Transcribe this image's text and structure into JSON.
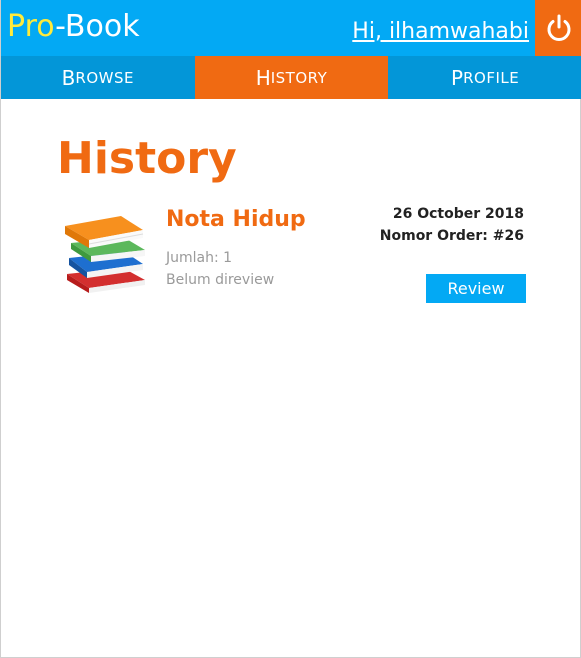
{
  "header": {
    "logo_pro": "Pro",
    "logo_dash": "-",
    "logo_book": "Book",
    "greeting": "Hi, ilhamwahabi",
    "logout_icon": "power-icon"
  },
  "nav": {
    "tabs": [
      {
        "first": "B",
        "rest": "ROWSE",
        "active": false
      },
      {
        "first": "H",
        "rest": "ISTORY",
        "active": true
      },
      {
        "first": "P",
        "rest": "ROFILE",
        "active": false
      }
    ]
  },
  "main": {
    "title": "History",
    "orders": [
      {
        "book_title": "Nota Hidup",
        "quantity": "Jumlah: 1",
        "review_status": "Belum direview",
        "date": "26 October 2018",
        "order_number": "Nomor Order: #26",
        "review_label": "Review",
        "image": "books-stack-image"
      }
    ]
  },
  "colors": {
    "primary": "#03a9f4",
    "accent": "#f06a12",
    "logo_yellow": "#ffeb3b"
  }
}
